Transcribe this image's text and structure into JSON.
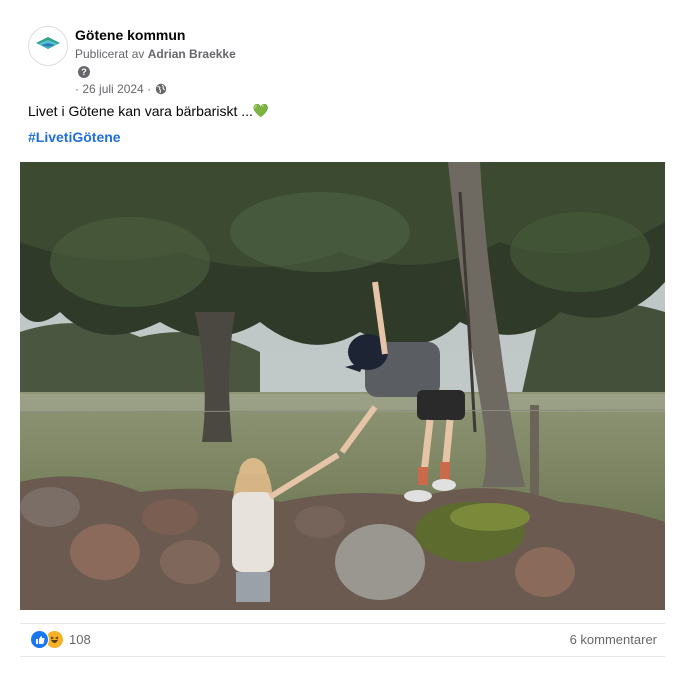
{
  "post": {
    "page_name": "Götene kommun",
    "published_prefix": "Publicerat av",
    "published_author": "Adrian Braekke",
    "help_glyph": "?",
    "date": "26 juli 2024",
    "text": "Livet i Götene kan vara bärbariskt ...",
    "heart_emoji": "💚",
    "hashtag": "#LivetiGötene"
  },
  "photo": {
    "alt": "A boy in a cap reaching down from a rock wall to help a young girl climb up, under a large tree in a meadow"
  },
  "footer": {
    "reaction_count": "108",
    "comments": "6 kommentarer",
    "reaction_icons": [
      "like-icon",
      "haha-icon"
    ]
  },
  "colors": {
    "link": "#216fdb",
    "muted": "#65676b",
    "like": "#1877f2",
    "haha": "#f7b125"
  }
}
